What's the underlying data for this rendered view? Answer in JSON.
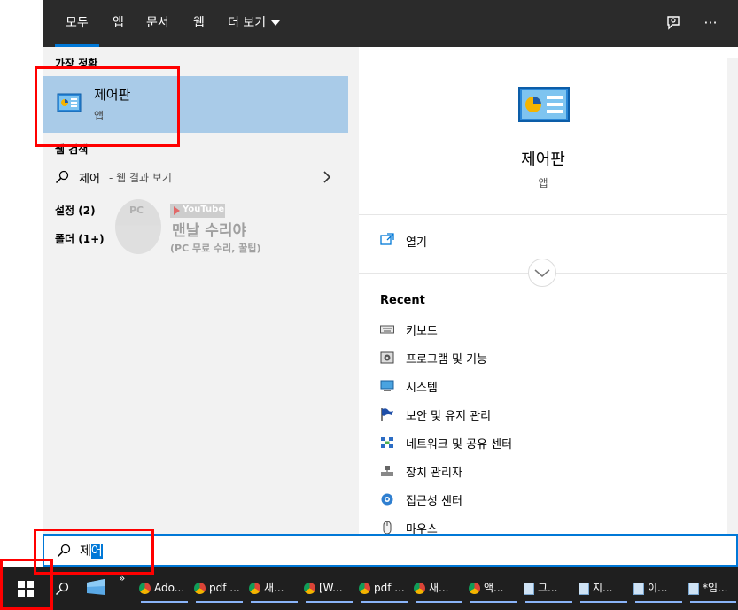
{
  "tabs": [
    {
      "label": "모두",
      "active": true
    },
    {
      "label": "앱"
    },
    {
      "label": "문서"
    },
    {
      "label": "웹"
    },
    {
      "label": "더 보기"
    }
  ],
  "left": {
    "best_match_heading": "가장 정확",
    "best_match": {
      "title": "제어판",
      "subtitle": "앱"
    },
    "web_search_heading": "웹 검색",
    "web_row": {
      "term": "제어",
      "suffix": " - 웹 결과 보기"
    },
    "settings": "설정 (2)",
    "folders": "폴더 (1+)"
  },
  "watermark": {
    "pc": "PC",
    "youtube": "YouTube",
    "name": "맨날 수리야",
    "tagline": "(PC 무료 수리, 꿀팁)"
  },
  "right": {
    "title": "제어판",
    "subtitle": "앱",
    "open_label": "열기",
    "recent_heading": "Recent",
    "recent": [
      {
        "label": "키보드",
        "icon": "keyboard-icon"
      },
      {
        "label": "프로그램 및 기능",
        "icon": "programs-icon"
      },
      {
        "label": "시스템",
        "icon": "system-icon"
      },
      {
        "label": "보안 및 유지 관리",
        "icon": "flag-icon"
      },
      {
        "label": "네트워크 및 공유 센터",
        "icon": "network-icon"
      },
      {
        "label": "장치 관리자",
        "icon": "device-manager-icon"
      },
      {
        "label": "접근성 센터",
        "icon": "accessibility-icon"
      },
      {
        "label": "마우스",
        "icon": "mouse-icon"
      }
    ]
  },
  "search": {
    "typed": "제",
    "selected": "어"
  },
  "taskbar": [
    {
      "label": "Ado...",
      "kind": "chrome"
    },
    {
      "label": "pdf ...",
      "kind": "chrome"
    },
    {
      "label": "새...",
      "kind": "chrome"
    },
    {
      "label": "[W...",
      "kind": "chrome"
    },
    {
      "label": "pdf ...",
      "kind": "chrome"
    },
    {
      "label": "새...",
      "kind": "chrome"
    },
    {
      "label": "액...",
      "kind": "chrome"
    },
    {
      "label": "그...",
      "kind": "notepad"
    },
    {
      "label": "지...",
      "kind": "notepad"
    },
    {
      "label": "이...",
      "kind": "notepad"
    },
    {
      "label": "*임...",
      "kind": "notepad"
    }
  ],
  "colors": {
    "accent": "#0078d7",
    "selection": "#a9cbe8",
    "topbar": "#2b2b2b",
    "highlight": "#ff0000"
  }
}
